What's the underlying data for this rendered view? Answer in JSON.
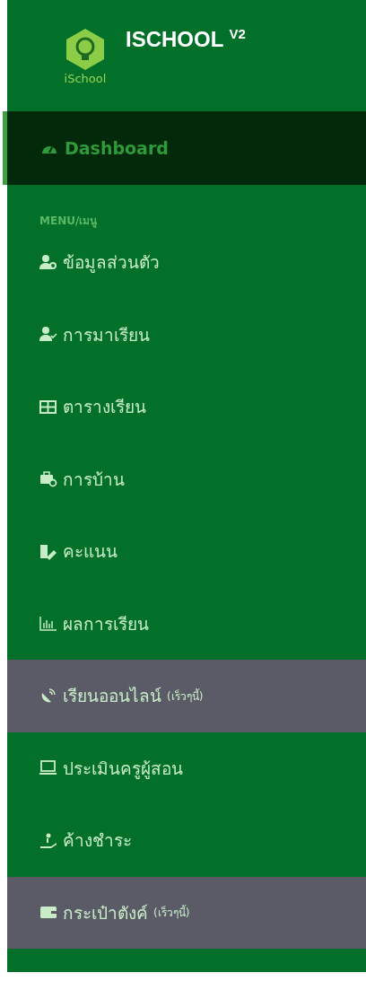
{
  "brand": {
    "logo_text": "iSchool",
    "title": "ISCHOOL",
    "version": "V2"
  },
  "dashboard": {
    "label": "Dashboard",
    "selected": true
  },
  "section_label": "MENU/เมนู",
  "menu": [
    {
      "label": "ข้อมูลส่วนตัว",
      "disabled": false
    },
    {
      "label": "การมาเรียน",
      "disabled": false
    },
    {
      "label": "ตารางเรียน",
      "disabled": false
    },
    {
      "label": "การบ้าน",
      "disabled": false
    },
    {
      "label": "คะแนน",
      "disabled": false
    },
    {
      "label": "ผลการเรียน",
      "disabled": false
    },
    {
      "label": "เรียนออนไลน์",
      "note": "(เร็วๆนี้)",
      "disabled": true
    },
    {
      "label": "ประเมินครูผู้สอน",
      "disabled": false
    },
    {
      "label": "ค้างชำระ",
      "disabled": false
    },
    {
      "label": "กระเป๋าตังค์",
      "note": "(เร็วๆนี้)",
      "disabled": true
    }
  ]
}
